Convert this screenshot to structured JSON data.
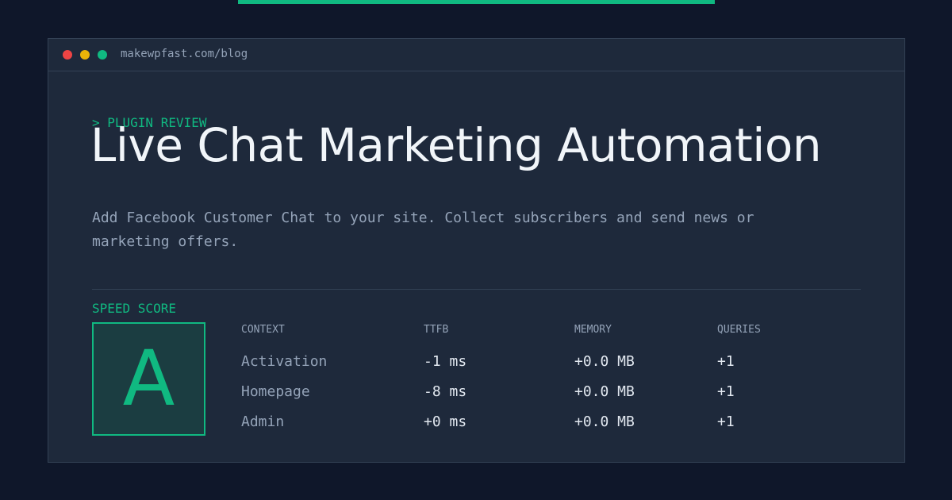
{
  "window": {
    "url": "makewpfast.com/blog",
    "controls": [
      "close",
      "minimize",
      "maximize"
    ]
  },
  "article": {
    "kicker": "> PLUGIN REVIEW",
    "title": "Live Chat Marketing Automation",
    "description": "Add Facebook Customer Chat to your site. Collect subscribers and send news or marketing offers."
  },
  "speed": {
    "label": "SPEED SCORE",
    "grade": "A",
    "columns": [
      "CONTEXT",
      "TTFB",
      "MEMORY",
      "QUERIES"
    ],
    "rows": [
      {
        "context": "Activation",
        "ttfb": "-1 ms",
        "memory": "+0.0 MB",
        "queries": "+1"
      },
      {
        "context": "Homepage",
        "ttfb": "-8 ms",
        "memory": "+0.0 MB",
        "queries": "+1"
      },
      {
        "context": "Admin",
        "ttfb": "+0 ms",
        "memory": "+0.0 MB",
        "queries": "+1"
      }
    ]
  },
  "colors": {
    "background": "#0f172a",
    "panel": "#1e293b",
    "accent": "#10b981",
    "dot_red": "#ef4444",
    "dot_yellow": "#eab308",
    "dot_green": "#10b981"
  }
}
